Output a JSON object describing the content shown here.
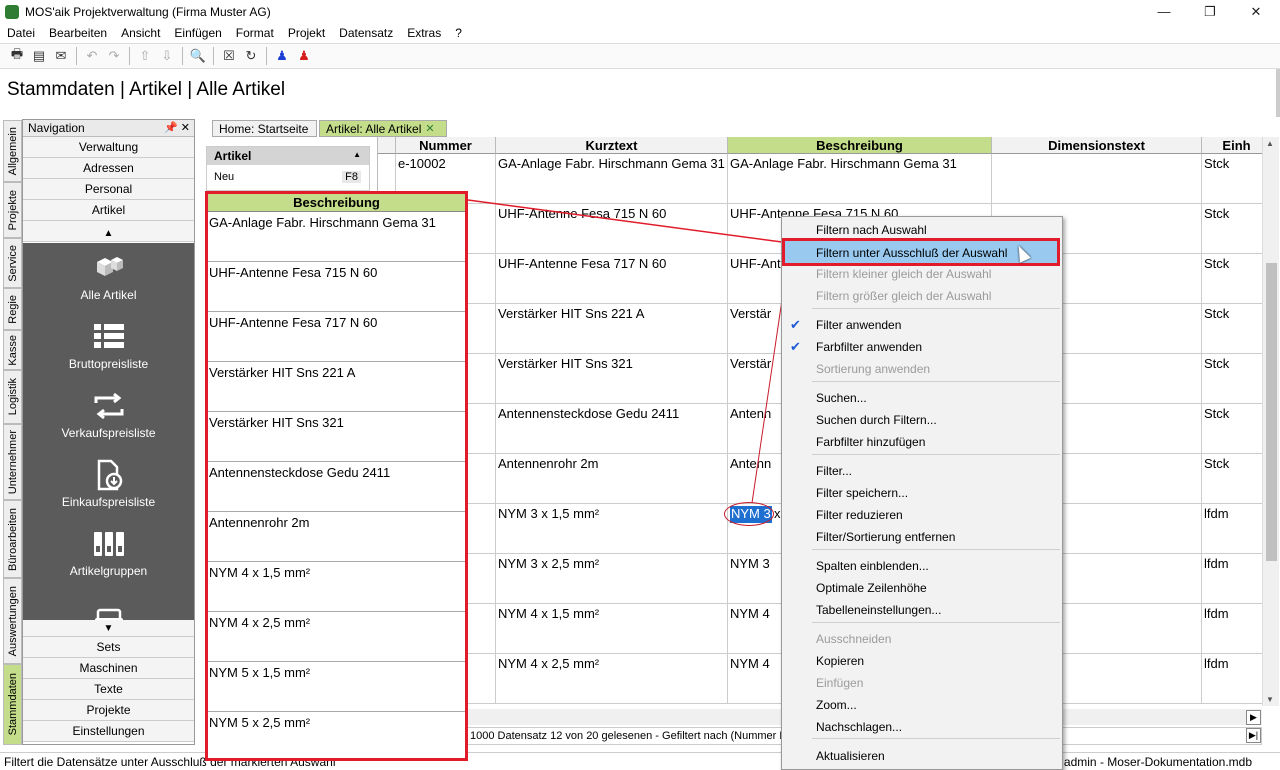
{
  "window": {
    "title": "MOS'aik Projektverwaltung (Firma Muster AG)",
    "min": "—",
    "max": "❐",
    "close": "✕"
  },
  "menu": [
    "Datei",
    "Bearbeiten",
    "Ansicht",
    "Einfügen",
    "Format",
    "Projekt",
    "Datensatz",
    "Extras",
    "?"
  ],
  "page_title": "Stammdaten | Artikel | Alle Artikel",
  "vertical_tabs": [
    "Allgemein",
    "Projekte",
    "Service",
    "Regie",
    "Kasse",
    "Logistik",
    "Unternehmer",
    "Büroarbeiten",
    "Auswertungen",
    "Stammdaten"
  ],
  "navigation": {
    "title": "Navigation",
    "pin": "📌",
    "close": "✕",
    "top_buttons": [
      "Verwaltung",
      "Adressen",
      "Personal",
      "Artikel"
    ],
    "items": [
      "Alle Artikel",
      "Bruttopreisliste",
      "Verkaufspreisliste",
      "Einkaufspreisliste",
      "Artikelgruppen"
    ],
    "bottom_buttons": [
      "Sets",
      "Maschinen",
      "Texte",
      "Projekte",
      "Einstellungen"
    ],
    "up": "▲",
    "down": "▼"
  },
  "tabs": [
    {
      "label": "Home: Startseite"
    },
    {
      "label": "Artikel: Alle Artikel",
      "close": "✕"
    }
  ],
  "side_panel": {
    "title": "Artikel",
    "caret": "▲",
    "item": "Neu",
    "shortcut": "F8"
  },
  "grid": {
    "headers": [
      "Nummer",
      "Kurztext",
      "Beschreibung",
      "Dimensionstext",
      "Einh"
    ],
    "rows": [
      [
        "e-10002",
        "GA-Anlage Fabr. Hirschmann Gema 31",
        "GA-Anlage Fabr. Hirschmann Gema 31",
        "",
        "Stck"
      ],
      [
        "",
        "UHF-Antenne Fesa 715 N 60",
        "UHF-Antenne Fesa 715 N 60",
        "",
        "Stck"
      ],
      [
        "",
        "UHF-Antenne Fesa 717 N 60",
        "UHF-Ant",
        "",
        "Stck"
      ],
      [
        "",
        "Verstärker HIT Sns 221 A",
        "Verstär",
        "",
        "Stck"
      ],
      [
        "",
        "Verstärker HIT Sns 321",
        "Verstär",
        "",
        "Stck"
      ],
      [
        "",
        "Antennensteckdose Gedu 2411",
        "Antenn",
        "",
        "Stck"
      ],
      [
        "",
        "Antennenrohr 2m",
        "Antenn",
        "",
        "Stck"
      ],
      [
        "",
        "NYM 3 x 1,5 mm²",
        "x",
        "",
        "lfdm"
      ],
      [
        "",
        "NYM 3 x 2,5 mm²",
        "NYM 3",
        "",
        "lfdm"
      ],
      [
        "",
        "NYM 4 x 1,5 mm²",
        "NYM 4",
        "",
        "lfdm"
      ],
      [
        "",
        "NYM 4 x 2,5 mm²",
        "NYM 4",
        "",
        "lfdm"
      ]
    ],
    "selected_text": "NYM 3"
  },
  "zoom_panel": {
    "header": "Beschreibung",
    "rows": [
      "GA-Anlage Fabr. Hirschmann Gema 31",
      "UHF-Antenne Fesa 715 N 60",
      "UHF-Antenne Fesa 717 N 60",
      "Verstärker HIT Sns 221 A",
      "Verstärker HIT Sns 321",
      "Antennensteckdose Gedu 2411",
      "Antennenrohr 2m",
      "NYM 4 x 1,5 mm²",
      "NYM 4 x 2,5 mm²",
      "NYM 5 x 1,5 mm²",
      "NYM 5 x 2,5 mm²"
    ]
  },
  "context_menu": {
    "items": [
      {
        "label": "Filtern nach Auswahl",
        "disabled": false
      },
      {
        "label": "Filtern unter Ausschluß der Auswahl",
        "highlighted": true
      },
      {
        "label": "Filtern kleiner gleich der Auswahl",
        "disabled": true
      },
      {
        "label": "Filtern größer gleich der Auswahl",
        "disabled": true
      },
      {
        "label": "Filter anwenden",
        "checked": true
      },
      {
        "label": "Farbfilter anwenden",
        "checked": true
      },
      {
        "label": "Sortierung anwenden",
        "disabled": true
      },
      {
        "label": "Suchen..."
      },
      {
        "label": "Suchen durch Filtern..."
      },
      {
        "label": "Farbfilter hinzufügen"
      },
      {
        "label": "Filter..."
      },
      {
        "label": "Filter speichern..."
      },
      {
        "label": "Filter reduzieren"
      },
      {
        "label": "Filter/Sortierung entfernen"
      },
      {
        "label": "Spalten einblenden..."
      },
      {
        "label": "Optimale Zeilenhöhe"
      },
      {
        "label": "Tabelleneinstellungen..."
      },
      {
        "label": "Ausschneiden",
        "disabled": true
      },
      {
        "label": "Kopieren"
      },
      {
        "label": "Einfügen",
        "disabled": true
      },
      {
        "label": "Zoom..."
      },
      {
        "label": "Nachschlagen..."
      },
      {
        "label": "Aktualisieren"
      }
    ],
    "check": "✔"
  },
  "record_status": "1000 Datensatz 12 von 20 gelesenen - Gefiltert nach (Nummer Lik",
  "status_left": "Filtert die Datensätze unter Ausschluß der markierten Auswahl",
  "status_right": "admin - Moser-Dokumentation.mdb",
  "colors": {
    "accent_green": "#c3dd8a",
    "highlight_red": "#e21b2a",
    "menu_highlight": "#99c9ef"
  }
}
